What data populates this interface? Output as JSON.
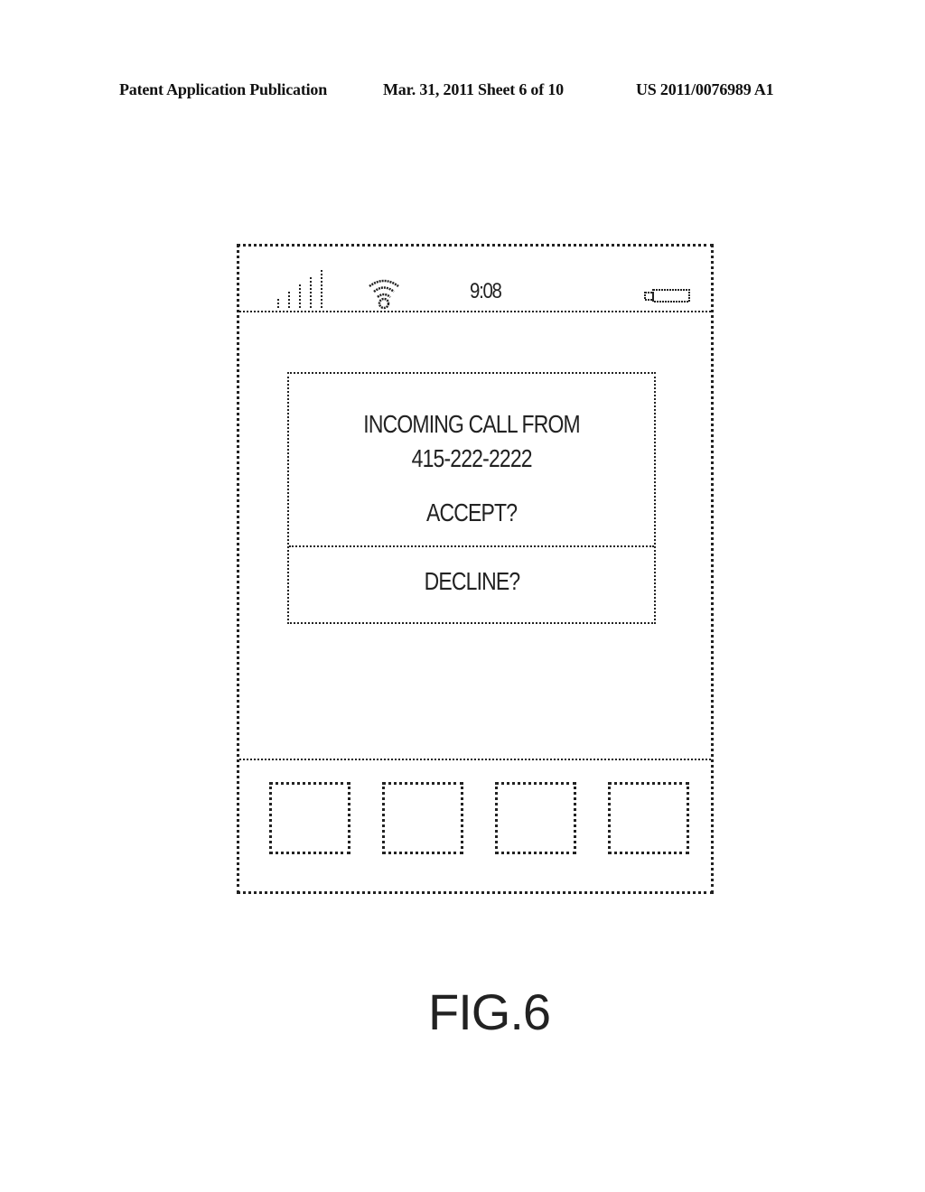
{
  "header": {
    "publication": "Patent Application Publication",
    "date_sheet": "Mar. 31, 2011  Sheet 6 of 10",
    "patent_number": "US 2011/0076989 A1"
  },
  "phone": {
    "status_bar": {
      "signal_icon": "signal-strength-icon",
      "signal_bars": 5,
      "wifi_icon": "wifi-icon",
      "time": "9:08",
      "battery_icon": "battery-icon"
    },
    "dialog": {
      "line1": "INCOMING CALL FROM",
      "line2": "415-222-2222",
      "accept_label": "ACCEPT?",
      "decline_label": "DECLINE?"
    },
    "dock": {
      "icons": [
        "app-icon",
        "app-icon",
        "app-icon",
        "app-icon"
      ]
    }
  },
  "figure_label": "FIG.6"
}
